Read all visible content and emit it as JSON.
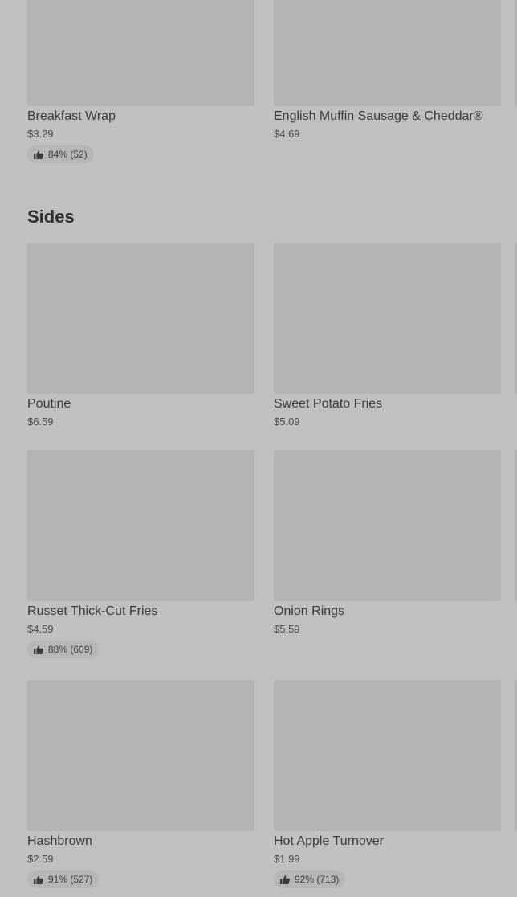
{
  "top_items": [
    {
      "name": "Breakfast Wrap",
      "price": "$3.29",
      "rating": "84% (52)"
    },
    {
      "name": "English Muffin Sausage & Cheddar®",
      "price": "$4.69"
    }
  ],
  "section": {
    "title": "Sides"
  },
  "sides": [
    {
      "name": "Poutine",
      "price": "$6.59"
    },
    {
      "name": "Sweet Potato Fries",
      "price": "$5.09"
    },
    {
      "name": "Russet Thick-Cut Fries",
      "price": "$4.59",
      "rating": "88% (609)"
    },
    {
      "name": "Onion Rings",
      "price": "$5.59"
    },
    {
      "name": "Hashbrown",
      "price": "$2.59",
      "rating": "91% (527)"
    },
    {
      "name": "Hot Apple Turnover",
      "price": "$1.99",
      "rating": "92% (713)"
    }
  ],
  "icons": {
    "rating": "thumbs-up-icon"
  }
}
